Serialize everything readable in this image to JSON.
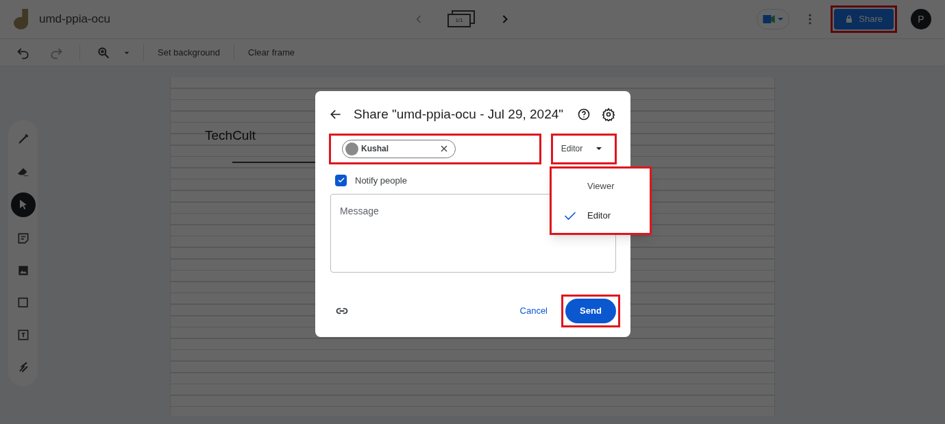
{
  "app": {
    "title": "umd-ppia-ocu"
  },
  "frame_nav": {
    "counter": "1/1"
  },
  "header": {
    "share_label": "Share",
    "avatar_initial": "P"
  },
  "toolbar": {
    "items": [
      "Set background",
      "Clear frame"
    ]
  },
  "tools": [
    {
      "kind": "pen",
      "selected": false
    },
    {
      "kind": "eraser",
      "selected": false
    },
    {
      "kind": "select",
      "selected": true
    },
    {
      "kind": "note",
      "selected": false
    },
    {
      "kind": "image",
      "selected": false
    },
    {
      "kind": "shape",
      "selected": false
    },
    {
      "kind": "textbox",
      "selected": false
    },
    {
      "kind": "laser",
      "selected": false
    }
  ],
  "canvas": {
    "text": "TechCult"
  },
  "dialog": {
    "title": "Share \"umd-ppia-ocu - Jul 29, 2024\"",
    "chips": [
      {
        "name": "Kushal"
      }
    ],
    "role": "Editor",
    "notify": {
      "label": "Notify people",
      "checked": true
    },
    "message": {
      "placeholder": "Message"
    },
    "cancel": "Cancel",
    "send": "Send"
  },
  "role_menu": [
    {
      "label": "Viewer",
      "selected": false
    },
    {
      "label": "Editor",
      "selected": true
    }
  ]
}
